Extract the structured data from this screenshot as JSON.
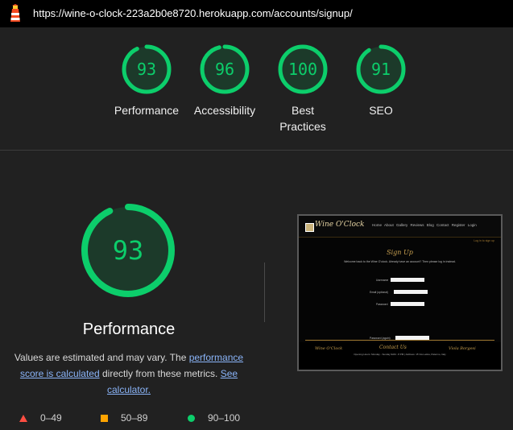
{
  "topbar": {
    "url": "https://wine-o-clock-223a2b0e8720.herokuapp.com/accounts/signup/",
    "icon": "lighthouse-icon"
  },
  "colors": {
    "pass": "#0cce6b",
    "average": "#ffa400",
    "fail": "#ff4e42",
    "link": "#8ab4f8"
  },
  "gauges": [
    {
      "score": 93,
      "label": "Performance"
    },
    {
      "score": 96,
      "label": "Accessibility"
    },
    {
      "score": 100,
      "label": "Best Practices",
      "label_line1": "Best",
      "label_line2": "Practices"
    },
    {
      "score": 91,
      "label": "SEO"
    }
  ],
  "main": {
    "score": 93,
    "title": "Performance",
    "note_text1": "Values are estimated and may vary. The ",
    "note_link1": "performance score is calculated",
    "note_text2": " directly from these metrics. ",
    "note_link2": "See calculator."
  },
  "legend": [
    {
      "shape": "triangle",
      "range": "0–49"
    },
    {
      "shape": "square",
      "range": "50–89"
    },
    {
      "shape": "circle",
      "range": "90–100"
    }
  ],
  "thumbnail": {
    "brand": "Wine O'Clock",
    "nav_links": "Home  About  Gallery  Reviews  Blog  Contact  Register  Login",
    "subnav": "Log in to sign up",
    "page_title": "Sign Up",
    "welcome": "Welcome back to the Wine O'clock. Already have an account? Then please log in instead.",
    "fields": [
      "Username",
      "Email (optional)",
      "Password",
      "Password (again)"
    ],
    "footer_left": "Wine O'Clock",
    "footer_center": "Contact Us",
    "footer_right": "Viola Borgesi",
    "footer_info": "Opening Hours: Monday - Sunday 9AM - 8 PM | Address: 15 Via Latina, Palermo, Italy"
  }
}
